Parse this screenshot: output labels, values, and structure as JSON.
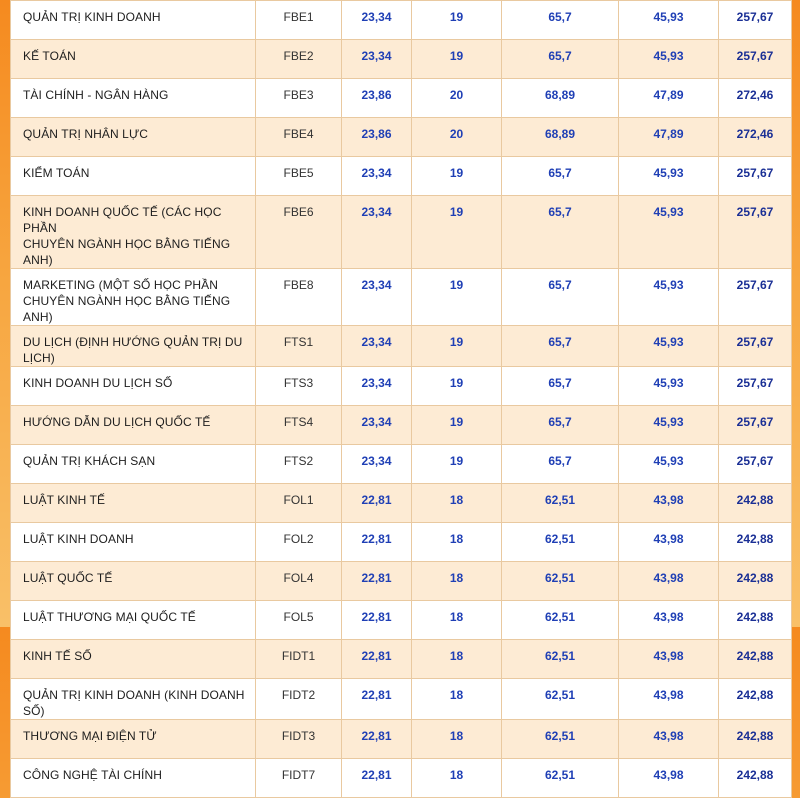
{
  "rows": [
    {
      "major": "QUẢN TRỊ KINH DOANH",
      "code": "FBE1",
      "v1": "23,34",
      "v2": "19",
      "v3": "65,7",
      "v4": "45,93",
      "v5": "257,67"
    },
    {
      "major": "KẾ TOÁN",
      "code": "FBE2",
      "v1": "23,34",
      "v2": "19",
      "v3": "65,7",
      "v4": "45,93",
      "v5": "257,67"
    },
    {
      "major": "TÀI CHÍNH - NGÂN HÀNG",
      "code": "FBE3",
      "v1": "23,86",
      "v2": "20",
      "v3": "68,89",
      "v4": "47,89",
      "v5": "272,46"
    },
    {
      "major": "QUẢN TRỊ NHÂN LỰC",
      "code": "FBE4",
      "v1": "23,86",
      "v2": "20",
      "v3": "68,89",
      "v4": "47,89",
      "v5": "272,46"
    },
    {
      "major": "KIỂM TOÁN",
      "code": "FBE5",
      "v1": "23,34",
      "v2": "19",
      "v3": "65,7",
      "v4": "45,93",
      "v5": "257,67"
    },
    {
      "major": "KINH DOANH QUỐC TẾ (CÁC HỌC PHẦN",
      "major2": "CHUYÊN NGÀNH HỌC BẰNG TIẾNG ANH)",
      "code": "FBE6",
      "v1": "23,34",
      "v2": "19",
      "v3": "65,7",
      "v4": "45,93",
      "v5": "257,67"
    },
    {
      "major": "MARKETING (MỘT SỐ HỌC PHẦN",
      "major2": "CHUYÊN NGÀNH HỌC BẰNG TIẾNG ANH)",
      "code": "FBE8",
      "v1": "23,34",
      "v2": "19",
      "v3": "65,7",
      "v4": "45,93",
      "v5": "257,67"
    },
    {
      "major": "DU LỊCH (ĐỊNH HƯỚNG QUẢN TRỊ DU LỊCH)",
      "code": "FTS1",
      "v1": "23,34",
      "v2": "19",
      "v3": "65,7",
      "v4": "45,93",
      "v5": "257,67"
    },
    {
      "major": "KINH DOANH DU LỊCH SỐ",
      "code": "FTS3",
      "v1": "23,34",
      "v2": "19",
      "v3": "65,7",
      "v4": "45,93",
      "v5": "257,67"
    },
    {
      "major": "HƯỚNG DẪN DU LỊCH QUỐC TẾ",
      "code": "FTS4",
      "v1": "23,34",
      "v2": "19",
      "v3": "65,7",
      "v4": "45,93",
      "v5": "257,67"
    },
    {
      "major": "QUẢN TRỊ KHÁCH SẠN",
      "code": "FTS2",
      "v1": "23,34",
      "v2": "19",
      "v3": "65,7",
      "v4": "45,93",
      "v5": "257,67"
    },
    {
      "major": "LUẬT KINH TẾ",
      "code": "FOL1",
      "v1": "22,81",
      "v2": "18",
      "v3": "62,51",
      "v4": "43,98",
      "v5": "242,88"
    },
    {
      "major": "LUẬT KINH DOANH",
      "code": "FOL2",
      "v1": "22,81",
      "v2": "18",
      "v3": "62,51",
      "v4": "43,98",
      "v5": "242,88"
    },
    {
      "major": "LUẬT QUỐC TẾ",
      "code": "FOL4",
      "v1": "22,81",
      "v2": "18",
      "v3": "62,51",
      "v4": "43,98",
      "v5": "242,88"
    },
    {
      "major": "LUẬT THƯƠNG MẠI QUỐC TẾ",
      "code": "FOL5",
      "v1": "22,81",
      "v2": "18",
      "v3": "62,51",
      "v4": "43,98",
      "v5": "242,88"
    },
    {
      "major": "KINH TẾ SỐ",
      "code": "FIDT1",
      "v1": "22,81",
      "v2": "18",
      "v3": "62,51",
      "v4": "43,98",
      "v5": "242,88"
    },
    {
      "major": "QUẢN TRỊ KINH DOANH (KINH DOANH SỐ)",
      "code": "FIDT2",
      "v1": "22,81",
      "v2": "18",
      "v3": "62,51",
      "v4": "43,98",
      "v5": "242,88"
    },
    {
      "major": "THƯƠNG MẠI ĐIỆN TỬ",
      "code": "FIDT3",
      "v1": "22,81",
      "v2": "18",
      "v3": "62,51",
      "v4": "43,98",
      "v5": "242,88"
    },
    {
      "major": "CÔNG NGHỆ TÀI CHÍNH",
      "code": "FIDT7",
      "v1": "22,81",
      "v2": "18",
      "v3": "62,51",
      "v4": "43,98",
      "v5": "242,88"
    }
  ]
}
